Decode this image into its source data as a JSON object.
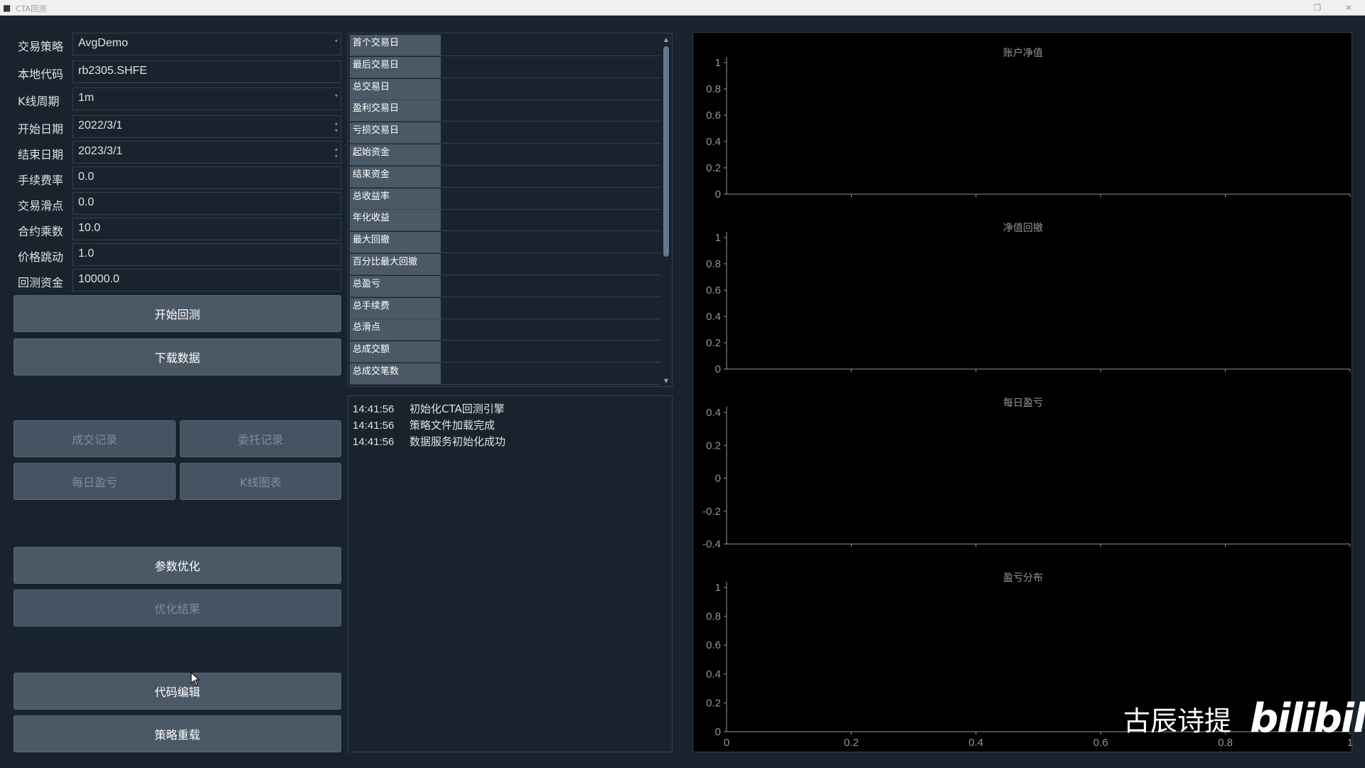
{
  "window": {
    "title": "CTA回测"
  },
  "form": {
    "strategy": {
      "label": "交易策略",
      "value": "AvgDemo"
    },
    "symbol": {
      "label": "本地代码",
      "value": "rb2305.SHFE"
    },
    "interval": {
      "label": "K线周期",
      "value": "1m"
    },
    "start_date": {
      "label": "开始日期",
      "value": "2022/3/1"
    },
    "end_date": {
      "label": "结束日期",
      "value": "2023/3/1"
    },
    "rate": {
      "label": "手续费率",
      "value": "0.0"
    },
    "slippage": {
      "label": "交易滑点",
      "value": "0.0"
    },
    "size": {
      "label": "合约乘数",
      "value": "10.0"
    },
    "pricetick": {
      "label": "价格跳动",
      "value": "1.0"
    },
    "capital": {
      "label": "回测资金",
      "value": "10000.0"
    }
  },
  "buttons": {
    "start_backtest": "开始回测",
    "download_data": "下载数据",
    "trade_records": "成交记录",
    "order_records": "委托记录",
    "daily_pnl": "每日盈亏",
    "candle_chart": "K线图表",
    "optimize": "参数优化",
    "optimize_result": "优化结果",
    "edit_code": "代码编辑",
    "reload_strategy": "策略重载"
  },
  "stats": [
    "首个交易日",
    "最后交易日",
    "总交易日",
    "盈利交易日",
    "亏损交易日",
    "起始资金",
    "结束资金",
    "总收益率",
    "年化收益",
    "最大回撤",
    "百分比最大回撤",
    "总盈亏",
    "总手续费",
    "总滑点",
    "总成交额",
    "总成交笔数"
  ],
  "log": [
    {
      "time": "14:41:56",
      "msg": "初始化CTA回测引擎"
    },
    {
      "time": "14:41:56",
      "msg": "策略文件加载完成"
    },
    {
      "time": "14:41:56",
      "msg": "数据服务初始化成功"
    }
  ],
  "charts": {
    "balance": {
      "title": "账户净值",
      "yticks": [
        "1",
        "0.8",
        "0.6",
        "0.4",
        "0.2",
        "0"
      ]
    },
    "drawdown": {
      "title": "净值回撤",
      "yticks": [
        "1",
        "0.8",
        "0.6",
        "0.4",
        "0.2",
        "0"
      ]
    },
    "daily_pnl": {
      "title": "每日盈亏",
      "yticks": [
        "0.4",
        "0.2",
        "0",
        "-0.2",
        "-0.4"
      ]
    },
    "pnl_dist": {
      "title": "盈亏分布",
      "yticks": [
        "1",
        "0.8",
        "0.6",
        "0.4",
        "0.2",
        "0"
      ],
      "xticks": [
        "0",
        "0.2",
        "0.4",
        "0.6",
        "0.8",
        "1"
      ]
    }
  },
  "chart_data": [
    {
      "type": "line",
      "title": "账户净值",
      "series": [],
      "ylim": [
        0,
        1
      ],
      "xlim": [
        0,
        1
      ],
      "grid": false
    },
    {
      "type": "area",
      "title": "净值回撤",
      "series": [],
      "ylim": [
        0,
        1
      ],
      "xlim": [
        0,
        1
      ],
      "grid": false
    },
    {
      "type": "bar",
      "title": "每日盈亏",
      "series": [],
      "ylim": [
        -0.5,
        0.5
      ],
      "xlim": [
        0,
        1
      ],
      "grid": false
    },
    {
      "type": "bar",
      "title": "盈亏分布",
      "series": [],
      "ylim": [
        0,
        1
      ],
      "xlim": [
        0,
        1
      ],
      "grid": false
    }
  ],
  "watermark": {
    "text": "古辰诗提",
    "logo": "bilibili"
  },
  "icons": {
    "app": "app-icon",
    "close": "close-icon",
    "restore": "restore-icon"
  },
  "colors": {
    "background": "#19232d",
    "button": "#4b5966",
    "chart_bg": "#000000",
    "axis": "#969696"
  }
}
